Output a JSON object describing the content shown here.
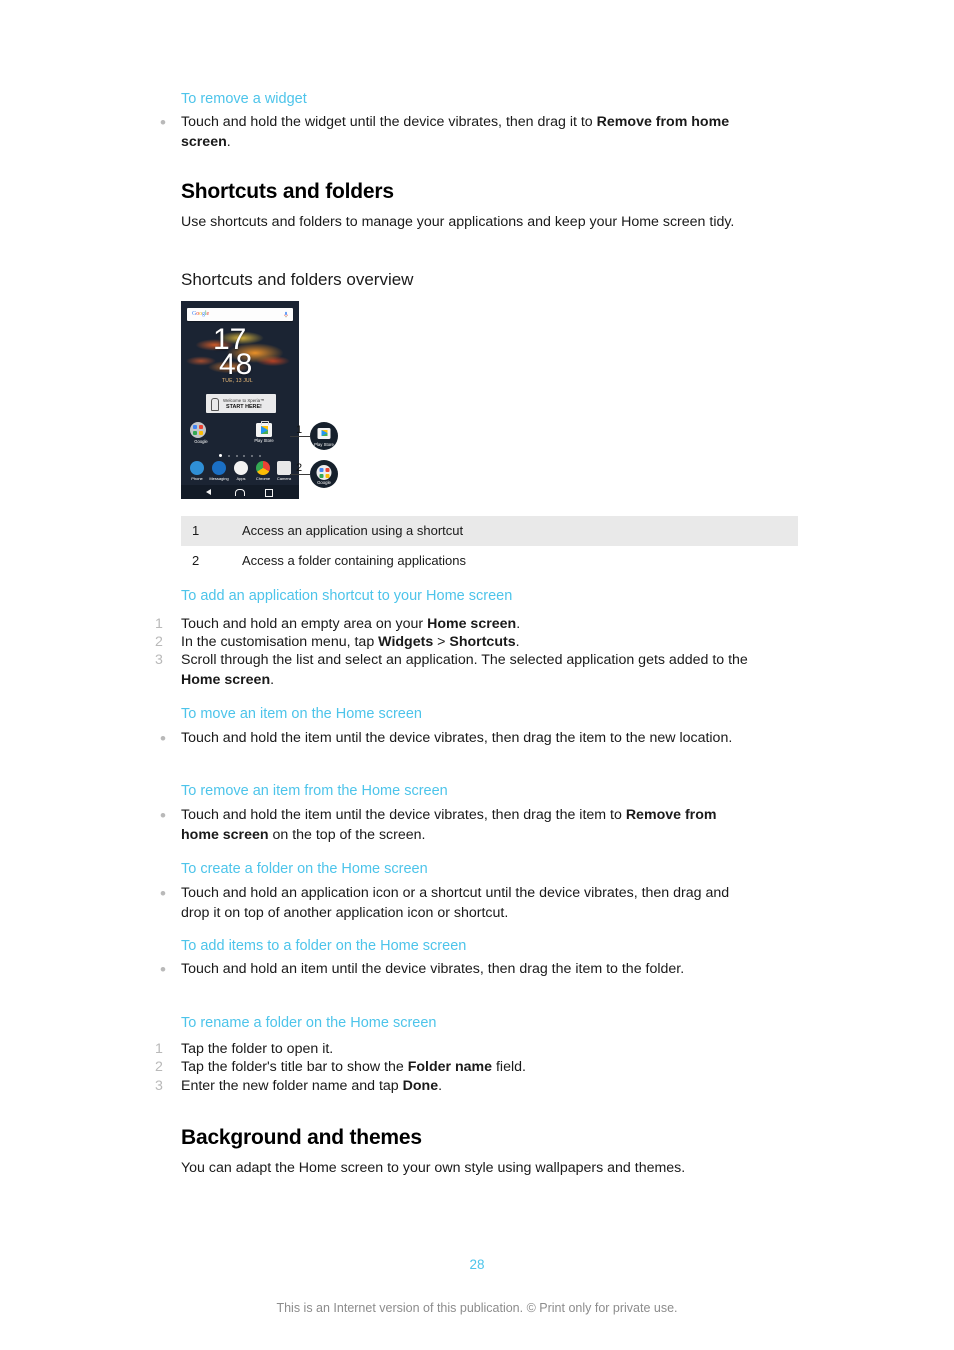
{
  "document": {
    "page_number": "28",
    "footnote": "This is an Internet version of this publication. © Print only for private use."
  },
  "sections": {
    "remove_widget": {
      "heading": "To remove a widget",
      "bullet_marker": "•",
      "text_plain": "Touch and hold the widget until the device vibrates, then drag it to ",
      "text_bold_1": "Remove from home screen",
      "text_end": "."
    },
    "shortcuts_and_folders": {
      "title": "Shortcuts and folders",
      "intro": "Use shortcuts and folders to manage your applications and keep your Home screen tidy.",
      "overview_title": "Shortcuts and folders overview"
    },
    "legend": {
      "rows": [
        {
          "number": "1",
          "description": "Access an application using a shortcut"
        },
        {
          "number": "2",
          "description": "Access a folder containing applications"
        }
      ]
    },
    "add_shortcut": {
      "heading": "To add an application shortcut to your Home screen",
      "steps": [
        {
          "num": "1",
          "pre": "Touch and hold an empty area on your ",
          "bold": "Home screen",
          "post": "."
        },
        {
          "num": "2",
          "pre": "In the customisation menu, tap ",
          "bold": "Widgets",
          "mid": " > ",
          "bold2": "Shortcuts",
          "post": "."
        },
        {
          "num": "3",
          "pre": "Scroll through the list and select an application. The selected application gets added to the ",
          "bold": "Home screen",
          "post": "."
        }
      ]
    },
    "move_item": {
      "heading": "To move an item on the Home screen",
      "bullet_marker": "•",
      "text": "Touch and hold the item until the device vibrates, then drag the item to the new location."
    },
    "remove_item": {
      "heading": "To remove an item from the Home screen",
      "bullet_marker": "•",
      "pre": "Touch and hold the item until the device vibrates, then drag the item to ",
      "bold": "Remove from home screen",
      "post": " on the top of the screen."
    },
    "create_folder": {
      "heading": "To create a folder on the Home screen",
      "bullet_marker": "•",
      "text": "Touch and hold an application icon or a shortcut until the device vibrates, then drag and drop it on top of another application icon or shortcut."
    },
    "add_items_folder": {
      "heading": "To add items to a folder on the Home screen",
      "bullet_marker": "•",
      "text": "Touch and hold an item until the device vibrates, then drag the item to the folder."
    },
    "rename_folder": {
      "heading": "To rename a folder on the Home screen",
      "steps": [
        {
          "num": "1",
          "pre": "Tap the folder to open it.",
          "bold": "",
          "post": ""
        },
        {
          "num": "2",
          "pre": "Tap the folder's title bar to show the ",
          "bold": "Folder name",
          "post": " field."
        },
        {
          "num": "3",
          "pre": "Enter the new folder name and tap ",
          "bold": "Done",
          "post": "."
        }
      ]
    },
    "background_themes": {
      "title": "Background and themes",
      "intro": "You can adapt the Home screen to your own style using wallpapers and themes."
    }
  },
  "phone_screenshot": {
    "search_widget": {
      "logo": "Google",
      "mic_icon": "microphone-icon"
    },
    "clock": {
      "hours": "17",
      "minutes": "48"
    },
    "date": "TUE, 13 JUL",
    "xperia_widget": {
      "line1": "Welcome to Xperia™",
      "line2": "START HERE!"
    },
    "home_icons": [
      {
        "name": "Google",
        "type": "folder"
      },
      {
        "name": "Play Store",
        "type": "shortcut"
      }
    ],
    "dock_icons": [
      "Phone",
      "Messaging",
      "Apps",
      "Chrome",
      "Camera"
    ],
    "nav_buttons": [
      "back-icon",
      "home-icon",
      "recents-icon"
    ],
    "page_indicator": {
      "pages": 6,
      "active": 1
    }
  },
  "callouts": [
    {
      "number": "1",
      "label": "Play Store",
      "icon": "play-store-icon"
    },
    {
      "number": "2",
      "label": "Google",
      "icon": "google-folder-icon"
    }
  ],
  "colors": {
    "accent_blue": "#4dc4ea",
    "table_row_shade": "#e9e9e9",
    "list_marker_gray": "#b9b9b9",
    "footnote_gray": "#8c8c8c"
  }
}
